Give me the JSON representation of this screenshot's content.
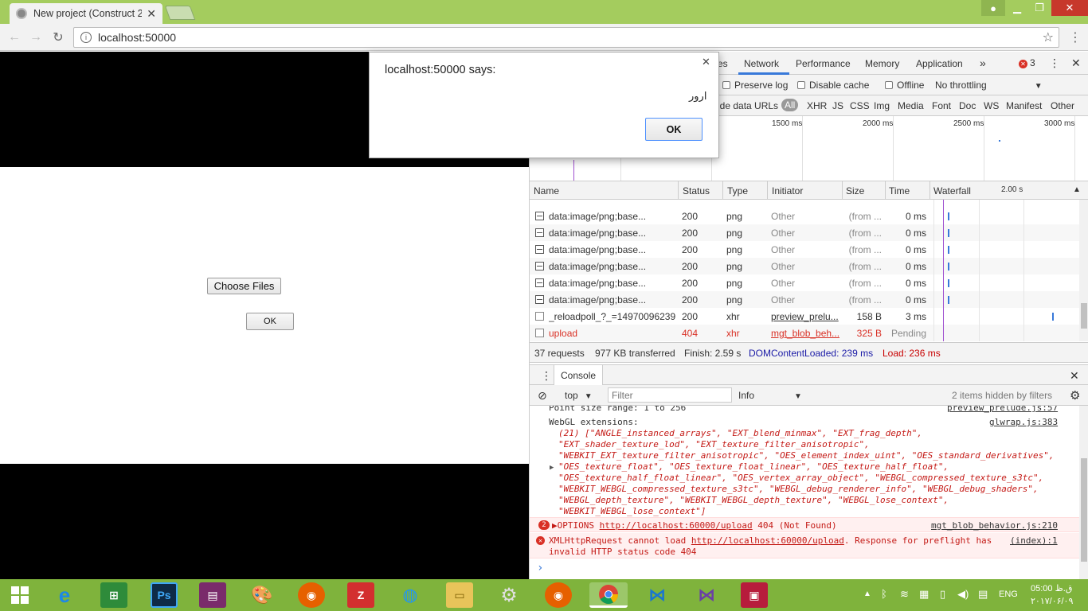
{
  "browser": {
    "tab_title": "New project (Construct 2",
    "url": "localhost:50000"
  },
  "page": {
    "choose_files_label": "Choose Files",
    "ok_label": "OK"
  },
  "dialog": {
    "title": "localhost:50000 says:",
    "message": "ارور",
    "ok_label": "OK"
  },
  "devtools": {
    "tabs": [
      "es",
      "Network",
      "Performance",
      "Memory",
      "Application"
    ],
    "more": "»",
    "error_count": "3",
    "options": {
      "preserve_log": "Preserve log",
      "disable_cache": "Disable cache",
      "offline": "Offline",
      "throttling": "No throttling"
    },
    "filters": {
      "hide_data": "ide data URLs",
      "all": "All",
      "types": [
        "XHR",
        "JS",
        "CSS",
        "Img",
        "Media",
        "Font",
        "Doc",
        "WS",
        "Manifest",
        "Other"
      ]
    },
    "timeline": [
      "1500 ms",
      "2000 ms",
      "2500 ms",
      "3000 ms"
    ],
    "columns": {
      "name": "Name",
      "status": "Status",
      "type": "Type",
      "initiator": "Initiator",
      "size": "Size",
      "time": "Time",
      "waterfall": "Waterfall",
      "waterfall_scale": "2.00 s"
    },
    "rows": [
      {
        "name": "data:image/png;base...",
        "status": "200",
        "type": "png",
        "initiator": "Other",
        "size": "(from ...",
        "time": "0 ms"
      },
      {
        "name": "data:image/png;base...",
        "status": "200",
        "type": "png",
        "initiator": "Other",
        "size": "(from ...",
        "time": "0 ms"
      },
      {
        "name": "data:image/png;base...",
        "status": "200",
        "type": "png",
        "initiator": "Other",
        "size": "(from ...",
        "time": "0 ms"
      },
      {
        "name": "data:image/png;base...",
        "status": "200",
        "type": "png",
        "initiator": "Other",
        "size": "(from ...",
        "time": "0 ms"
      },
      {
        "name": "data:image/png;base...",
        "status": "200",
        "type": "png",
        "initiator": "Other",
        "size": "(from ...",
        "time": "0 ms"
      },
      {
        "name": "data:image/png;base...",
        "status": "200",
        "type": "png",
        "initiator": "Other",
        "size": "(from ...",
        "time": "0 ms"
      },
      {
        "name": "_reloadpoll_?_=14970096239...",
        "status": "200",
        "type": "xhr",
        "initiator": "preview_prelu...",
        "size": "158 B",
        "time": "3 ms"
      },
      {
        "name": "upload",
        "status": "404",
        "type": "xhr",
        "initiator": "mgt_blob_beh...",
        "size": "325 B",
        "time": "Pending"
      }
    ],
    "summary": {
      "requests": "37 requests",
      "transferred": "977 KB transferred",
      "finish": "Finish: 2.59 s",
      "dcl": "DOMContentLoaded: 239 ms",
      "load": "Load: 236 ms"
    },
    "drawer_tab": "Console",
    "console_context": "top",
    "filter_placeholder": "Filter",
    "level": "Info",
    "hidden_msg": "2 items hidden by filters",
    "console": {
      "cut_line": "Point size range: 1 to 256",
      "cut_src": "preview_prelude.js:57",
      "webgl_label": "WebGL extensions:",
      "webgl_src": "glwrap.js:383",
      "webgl_lines": [
        "(21) [\"ANGLE_instanced_arrays\", \"EXT_blend_minmax\", \"EXT_frag_depth\",",
        "\"EXT_shader_texture_lod\", \"EXT_texture_filter_anisotropic\",",
        "\"WEBKIT_EXT_texture_filter_anisotropic\", \"OES_element_index_uint\", \"OES_standard_derivatives\",",
        "\"OES_texture_float\", \"OES_texture_float_linear\", \"OES_texture_half_float\",",
        "\"OES_texture_half_float_linear\", \"OES_vertex_array_object\", \"WEBGL_compressed_texture_s3tc\",",
        "\"WEBKIT_WEBGL_compressed_texture_s3tc\", \"WEBGL_debug_renderer_info\", \"WEBGL_debug_shaders\",",
        "\"WEBGL_depth_texture\", \"WEBKIT_WEBGL_depth_texture\", \"WEBGL_lose_context\",",
        "\"WEBKIT_WEBGL_lose_context\"]"
      ],
      "err1_count": "2",
      "err1_prefix": "▶OPTIONS ",
      "err1_url": "http://localhost:60000/upload",
      "err1_rest": " 404 (Not Found)",
      "err1_src": "mgt_blob_behavior.js:210",
      "err2_prefix": "XMLHttpRequest cannot load ",
      "err2_url": "http://localhost:60000/upload",
      "err2_rest": ". Response for preflight has",
      "err2_line2": "invalid HTTP status code 404",
      "err2_src": "(index):1",
      "prompt": "›"
    }
  },
  "taskbar": {
    "lang": "ENG",
    "time": "05:00 ق.ظ",
    "date": "۲۰۱۷/۰۶/۰۹"
  },
  "colors": {
    "titlebar": "#a4cc5e",
    "taskbar": "#7fb33c",
    "error": "#d93025",
    "link_blue": "#1a1aa6"
  }
}
